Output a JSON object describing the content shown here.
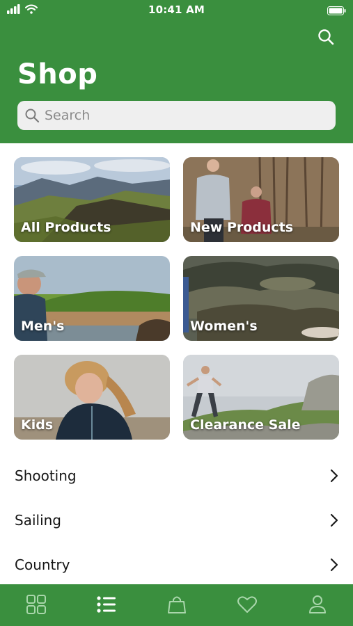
{
  "status_bar": {
    "time": "10:41 AM"
  },
  "header": {
    "title": "Shop"
  },
  "search": {
    "placeholder": "Search"
  },
  "tiles": [
    {
      "label": "All Products"
    },
    {
      "label": "New Products"
    },
    {
      "label": "Men's"
    },
    {
      "label": "Women's"
    },
    {
      "label": "Kids"
    },
    {
      "label": "Clearance Sale"
    }
  ],
  "categories": [
    {
      "label": "Shooting"
    },
    {
      "label": "Sailing"
    },
    {
      "label": "Country"
    }
  ],
  "tab_bar": {
    "items": [
      {
        "icon": "grid-icon",
        "active": false
      },
      {
        "icon": "list-icon",
        "active": true
      },
      {
        "icon": "shopping-bag-icon",
        "active": false
      },
      {
        "icon": "heart-icon",
        "active": false
      },
      {
        "icon": "profile-icon",
        "active": false
      }
    ]
  },
  "colors": {
    "brand_green": "#3a8f3e",
    "search_bg": "#efefef",
    "tab_active": "#ffffff",
    "tab_inactive": "#a9d6ab"
  }
}
